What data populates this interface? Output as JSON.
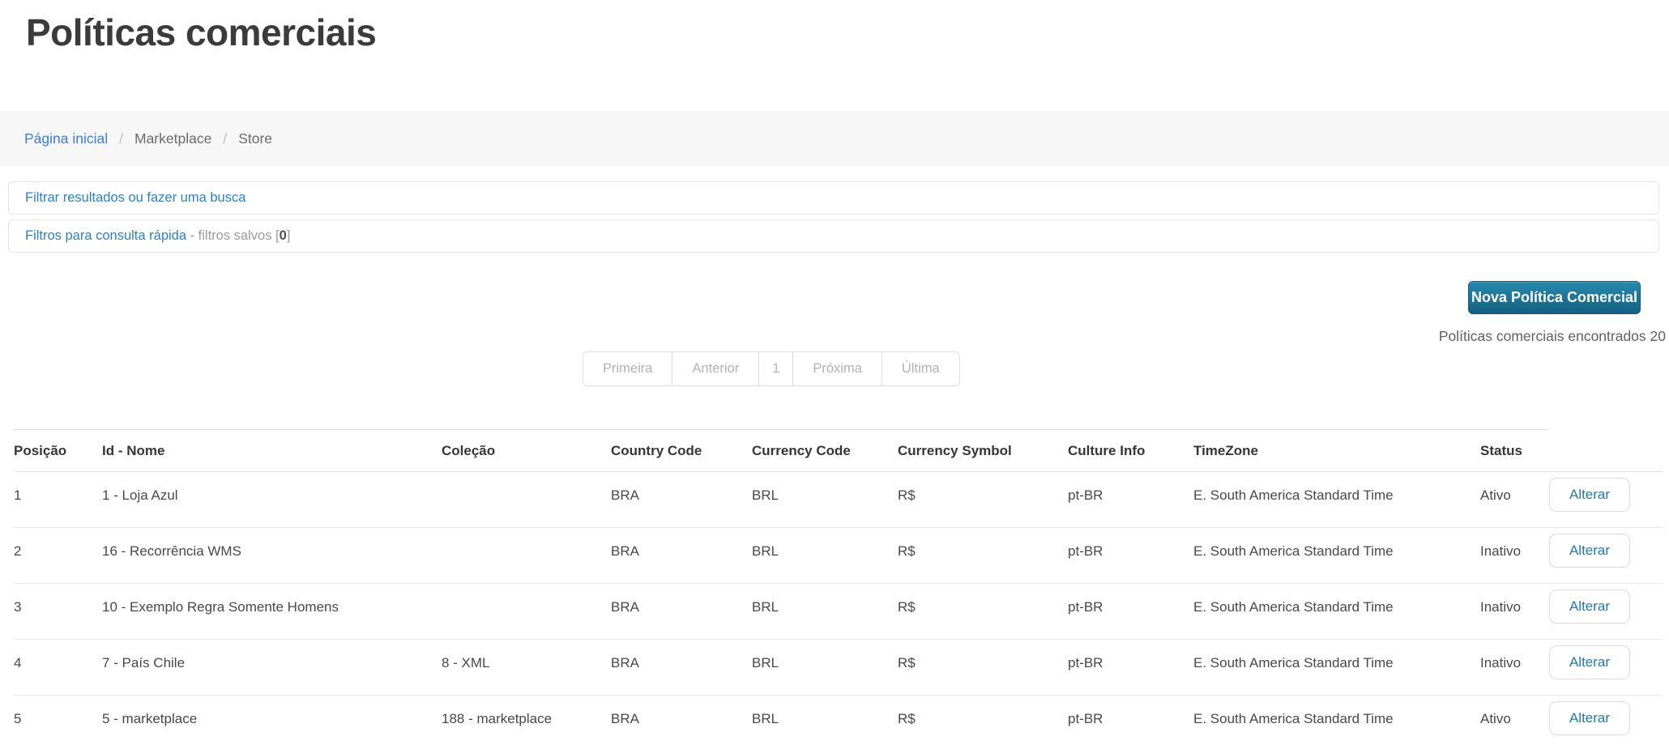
{
  "page": {
    "title": "Políticas comerciais"
  },
  "breadcrumb": {
    "separator": "/",
    "items": [
      {
        "label": "Página inicial"
      },
      {
        "label": "Marketplace"
      },
      {
        "label": "Store"
      }
    ]
  },
  "filters": {
    "search_bar_label": "Filtrar resultados ou fazer uma busca",
    "quick_filter_label": "Filtros para consulta rápida",
    "saved_filters_prefix": " - filtros salvos [",
    "saved_count": "0",
    "saved_filters_suffix": "]"
  },
  "actions": {
    "new_policy_button": "Nova Política Comercial",
    "results_summary": "Políticas comerciais encontrados 20"
  },
  "pagination": {
    "first": "Primeira",
    "previous": "Anterior",
    "current_page": "1",
    "next": "Próxima",
    "last": "Última"
  },
  "table": {
    "columns": [
      "Posição",
      "Id - Nome",
      "Coleção",
      "Country Code",
      "Currency Code",
      "Currency Symbol",
      "Culture Info",
      "TimeZone",
      "Status"
    ],
    "action_label": "Alterar",
    "rows": [
      {
        "position": "1",
        "id_name": "1 - Loja Azul",
        "collection": "",
        "country_code": "BRA",
        "currency_code": "BRL",
        "currency_symbol": "R$",
        "culture_info": "pt-BR",
        "timezone": "E. South America Standard Time",
        "status": "Ativo"
      },
      {
        "position": "2",
        "id_name": "16 - Recorrência WMS",
        "collection": "",
        "country_code": "BRA",
        "currency_code": "BRL",
        "currency_symbol": "R$",
        "culture_info": "pt-BR",
        "timezone": "E. South America Standard Time",
        "status": "Inativo"
      },
      {
        "position": "3",
        "id_name": "10 - Exemplo Regra Somente Homens",
        "collection": "",
        "country_code": "BRA",
        "currency_code": "BRL",
        "currency_symbol": "R$",
        "culture_info": "pt-BR",
        "timezone": "E. South America Standard Time",
        "status": "Inativo"
      },
      {
        "position": "4",
        "id_name": "7 - País Chile",
        "collection": "8 - XML",
        "country_code": "BRA",
        "currency_code": "BRL",
        "currency_symbol": "R$",
        "culture_info": "pt-BR",
        "timezone": "E. South America Standard Time",
        "status": "Inativo"
      },
      {
        "position": "5",
        "id_name": "5 - marketplace",
        "collection": "188 - marketplace",
        "country_code": "BRA",
        "currency_code": "BRL",
        "currency_symbol": "R$",
        "culture_info": "pt-BR",
        "timezone": "E. South America Standard Time",
        "status": "Ativo"
      }
    ]
  },
  "colors": {
    "link_blue": "#3d7edd",
    "filter_blue": "#2e80c4",
    "action_blue": "#2478a9",
    "btn_top": "#2689b0",
    "btn_bottom": "#15607f",
    "btn_border": "#155c7b"
  }
}
